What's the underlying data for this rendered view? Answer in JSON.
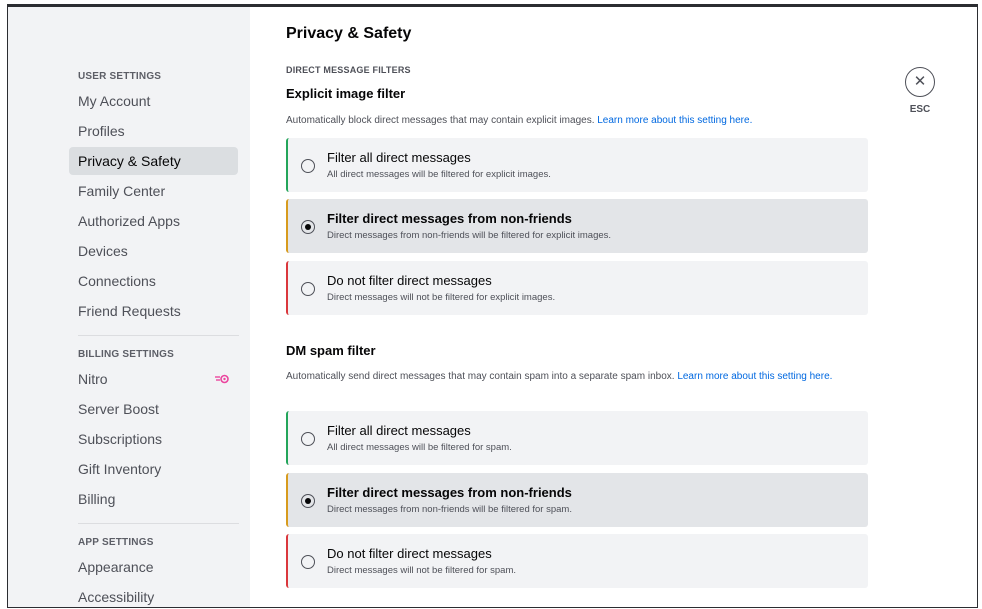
{
  "sidebar": {
    "user_header": "USER SETTINGS",
    "user_items": [
      "My Account",
      "Profiles",
      "Privacy & Safety",
      "Family Center",
      "Authorized Apps",
      "Devices",
      "Connections",
      "Friend Requests"
    ],
    "billing_header": "BILLING SETTINGS",
    "billing_items": [
      "Nitro",
      "Server Boost",
      "Subscriptions",
      "Gift Inventory",
      "Billing"
    ],
    "app_header": "APP SETTINGS",
    "app_items": [
      "Appearance",
      "Accessibility"
    ],
    "selected": "Privacy & Safety",
    "nitro_icon": "nitro-icon"
  },
  "main": {
    "title": "Privacy & Safety",
    "section_label": "DIRECT MESSAGE FILTERS",
    "explicit": {
      "title": "Explicit image filter",
      "desc": "Automatically block direct messages that may contain explicit images.",
      "link": "Learn more about this setting here.",
      "options": [
        {
          "title": "Filter all direct messages",
          "desc": "All direct messages will be filtered for explicit images.",
          "checked": false
        },
        {
          "title": "Filter direct messages from non-friends",
          "desc": "Direct messages from non-friends will be filtered for explicit images.",
          "checked": true
        },
        {
          "title": "Do not filter direct messages",
          "desc": "Direct messages will not be filtered for explicit images.",
          "checked": false
        }
      ]
    },
    "spam": {
      "title": "DM spam filter",
      "desc": "Automatically send direct messages that may contain spam into a separate spam inbox.",
      "link": "Learn more about this setting here.",
      "options": [
        {
          "title": "Filter all direct messages",
          "desc": "All direct messages will be filtered for spam.",
          "checked": false
        },
        {
          "title": "Filter direct messages from non-friends",
          "desc": "Direct messages from non-friends will be filtered for spam.",
          "checked": true
        },
        {
          "title": "Do not filter direct messages",
          "desc": "Direct messages will not be filtered for spam.",
          "checked": false
        }
      ]
    }
  },
  "close": {
    "symbol": "✕",
    "label": "ESC"
  },
  "colors": {
    "green": "#23a55a",
    "orange": "#d79b1e",
    "red": "#da373c",
    "link": "#0068e0",
    "nitro": "#eb459e"
  }
}
